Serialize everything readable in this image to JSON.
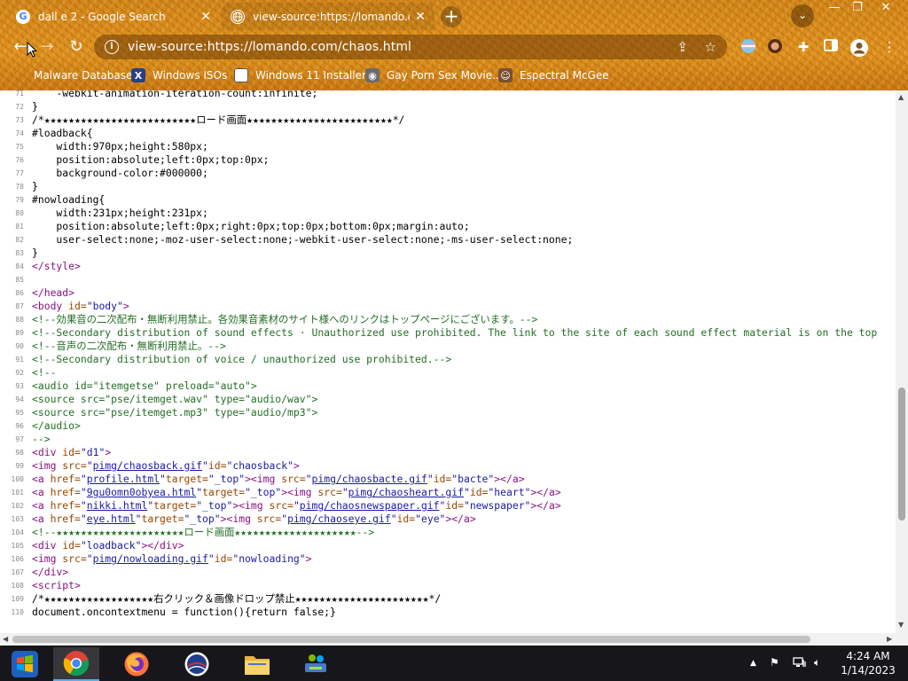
{
  "tabs": [
    {
      "title": "dall e 2 - Google Search",
      "icon": "google-icon"
    },
    {
      "title": "view-source:https://lomando.com",
      "icon": "globe-icon"
    }
  ],
  "address_bar": {
    "url": "view-source:https://lomando.com/chaos.html"
  },
  "bookmarks": [
    {
      "label": "Malware Database"
    },
    {
      "label": "Windows ISOs"
    },
    {
      "label": "Windows 11 Installer"
    },
    {
      "label": "Gay Porn Sex Movie..."
    },
    {
      "label": "Espectral McGee"
    }
  ],
  "source": {
    "lines": [
      {
        "n": "71",
        "segs": [
          {
            "t": "    -webkit-animation-iteration-count:infinite;",
            "c": ""
          }
        ]
      },
      {
        "n": "72",
        "segs": [
          {
            "t": "}",
            "c": ""
          }
        ]
      },
      {
        "n": "73",
        "segs": [
          {
            "t": "/*★★★★★★★★★★★★★★★★★★★★★★★★★ロード画面★★★★★★★★★★★★★★★★★★★★★★★★*/",
            "c": ""
          }
        ]
      },
      {
        "n": "74",
        "segs": [
          {
            "t": "#loadback{",
            "c": ""
          }
        ]
      },
      {
        "n": "75",
        "segs": [
          {
            "t": "    width:970px;height:580px;",
            "c": ""
          }
        ]
      },
      {
        "n": "76",
        "segs": [
          {
            "t": "    position:absolute;left:0px;top:0px;",
            "c": ""
          }
        ]
      },
      {
        "n": "77",
        "segs": [
          {
            "t": "    background-color:#000000;",
            "c": ""
          }
        ]
      },
      {
        "n": "78",
        "segs": [
          {
            "t": "}",
            "c": ""
          }
        ]
      },
      {
        "n": "79",
        "segs": [
          {
            "t": "#nowloading{",
            "c": ""
          }
        ]
      },
      {
        "n": "80",
        "segs": [
          {
            "t": "    width:231px;height:231px;",
            "c": ""
          }
        ]
      },
      {
        "n": "81",
        "segs": [
          {
            "t": "    position:absolute;left:0px;right:0px;top:0px;bottom:0px;margin:auto;",
            "c": ""
          }
        ]
      },
      {
        "n": "82",
        "segs": [
          {
            "t": "    user-select:none;-moz-user-select:none;-webkit-user-select:none;-ms-user-select:none;",
            "c": ""
          }
        ]
      },
      {
        "n": "83",
        "segs": [
          {
            "t": "}",
            "c": ""
          }
        ]
      },
      {
        "n": "84",
        "segs": [
          {
            "t": "</style>",
            "c": "tag"
          }
        ]
      },
      {
        "n": "85",
        "segs": []
      },
      {
        "n": "86",
        "segs": [
          {
            "t": "</head>",
            "c": "tag"
          }
        ]
      },
      {
        "n": "87",
        "segs": [
          {
            "t": "<body ",
            "c": "tag"
          },
          {
            "t": "id=",
            "c": "an"
          },
          {
            "t": "\"body\"",
            "c": "av"
          },
          {
            "t": ">",
            "c": "tag"
          }
        ]
      },
      {
        "n": "88",
        "segs": [
          {
            "t": "<!--効果音の二次配布・無断利用禁止。各効果音素材のサイト様へのリンクはトップページにございます。-->",
            "c": "cm"
          }
        ]
      },
      {
        "n": "89",
        "segs": [
          {
            "t": "<!--Secondary distribution of sound effects · Unauthorized use prohibited. The link to the site of each sound effect material is on the top",
            "c": "cm"
          }
        ]
      },
      {
        "n": "90",
        "segs": [
          {
            "t": "<!--音声の二次配布・無断利用禁止。-->",
            "c": "cm"
          }
        ]
      },
      {
        "n": "91",
        "segs": [
          {
            "t": "<!--Secondary distribution of voice / unauthorized use prohibited.-->",
            "c": "cm"
          }
        ]
      },
      {
        "n": "92",
        "segs": [
          {
            "t": "<!--",
            "c": "cm"
          }
        ]
      },
      {
        "n": "93",
        "segs": [
          {
            "t": "<audio id=\"itemgetse\" preload=\"auto\">",
            "c": "cm"
          }
        ]
      },
      {
        "n": "94",
        "segs": [
          {
            "t": "<source src=\"pse/itemget.wav\" type=\"audio/wav\">",
            "c": "cm"
          }
        ]
      },
      {
        "n": "95",
        "segs": [
          {
            "t": "<source src=\"pse/itemget.mp3\" type=\"audio/mp3\">",
            "c": "cm"
          }
        ]
      },
      {
        "n": "96",
        "segs": [
          {
            "t": "</audio>",
            "c": "cm"
          }
        ]
      },
      {
        "n": "97",
        "segs": [
          {
            "t": "-->",
            "c": "cm"
          }
        ]
      },
      {
        "n": "98",
        "segs": [
          {
            "t": "<div ",
            "c": "tag"
          },
          {
            "t": "id=",
            "c": "an"
          },
          {
            "t": "\"d1\"",
            "c": "av"
          },
          {
            "t": ">",
            "c": "tag"
          }
        ]
      },
      {
        "n": "99",
        "segs": [
          {
            "t": "<img ",
            "c": "tag"
          },
          {
            "t": "src=",
            "c": "an"
          },
          {
            "t": "\"",
            "c": "av"
          },
          {
            "t": "pimg/chaosback.gif",
            "c": "lk"
          },
          {
            "t": "\"",
            "c": "av"
          },
          {
            "t": "id=",
            "c": "an"
          },
          {
            "t": "\"chaosback\"",
            "c": "av"
          },
          {
            "t": ">",
            "c": "tag"
          }
        ]
      },
      {
        "n": "100",
        "segs": [
          {
            "t": "<a ",
            "c": "tag"
          },
          {
            "t": "href=",
            "c": "an"
          },
          {
            "t": "\"",
            "c": "av"
          },
          {
            "t": "profile.html",
            "c": "lk"
          },
          {
            "t": "\"",
            "c": "av"
          },
          {
            "t": "target=",
            "c": "an"
          },
          {
            "t": "\"_top\"",
            "c": "av"
          },
          {
            "t": "><img ",
            "c": "tag"
          },
          {
            "t": "src=",
            "c": "an"
          },
          {
            "t": "\"",
            "c": "av"
          },
          {
            "t": "pimg/chaosbacte.gif",
            "c": "lk"
          },
          {
            "t": "\"",
            "c": "av"
          },
          {
            "t": "id=",
            "c": "an"
          },
          {
            "t": "\"bacte\"",
            "c": "av"
          },
          {
            "t": "></a>",
            "c": "tag"
          }
        ]
      },
      {
        "n": "101",
        "segs": [
          {
            "t": "<a ",
            "c": "tag"
          },
          {
            "t": "href=",
            "c": "an"
          },
          {
            "t": "\"",
            "c": "av"
          },
          {
            "t": "9gu0omn0obyea.html",
            "c": "lk"
          },
          {
            "t": "\"",
            "c": "av"
          },
          {
            "t": "target=",
            "c": "an"
          },
          {
            "t": "\"_top\"",
            "c": "av"
          },
          {
            "t": "><img ",
            "c": "tag"
          },
          {
            "t": "src=",
            "c": "an"
          },
          {
            "t": "\"",
            "c": "av"
          },
          {
            "t": "pimg/chaosheart.gif",
            "c": "lk"
          },
          {
            "t": "\"",
            "c": "av"
          },
          {
            "t": "id=",
            "c": "an"
          },
          {
            "t": "\"heart\"",
            "c": "av"
          },
          {
            "t": "></a>",
            "c": "tag"
          }
        ]
      },
      {
        "n": "102",
        "segs": [
          {
            "t": "<a ",
            "c": "tag"
          },
          {
            "t": "href=",
            "c": "an"
          },
          {
            "t": "\"",
            "c": "av"
          },
          {
            "t": "nikki.html",
            "c": "lk"
          },
          {
            "t": "\"",
            "c": "av"
          },
          {
            "t": "target=",
            "c": "an"
          },
          {
            "t": "\"_top\"",
            "c": "av"
          },
          {
            "t": "><img ",
            "c": "tag"
          },
          {
            "t": "src=",
            "c": "an"
          },
          {
            "t": "\"",
            "c": "av"
          },
          {
            "t": "pimg/chaosnewspaper.gif",
            "c": "lk"
          },
          {
            "t": "\"",
            "c": "av"
          },
          {
            "t": "id=",
            "c": "an"
          },
          {
            "t": "\"newspaper\"",
            "c": "av"
          },
          {
            "t": "></a>",
            "c": "tag"
          }
        ]
      },
      {
        "n": "103",
        "segs": [
          {
            "t": "<a ",
            "c": "tag"
          },
          {
            "t": "href=",
            "c": "an"
          },
          {
            "t": "\"",
            "c": "av"
          },
          {
            "t": "eye.html",
            "c": "lk"
          },
          {
            "t": "\"",
            "c": "av"
          },
          {
            "t": "target=",
            "c": "an"
          },
          {
            "t": "\"_top\"",
            "c": "av"
          },
          {
            "t": "><img ",
            "c": "tag"
          },
          {
            "t": "src=",
            "c": "an"
          },
          {
            "t": "\"",
            "c": "av"
          },
          {
            "t": "pimg/chaoseye.gif",
            "c": "lk"
          },
          {
            "t": "\"",
            "c": "av"
          },
          {
            "t": "id=",
            "c": "an"
          },
          {
            "t": "\"eye\"",
            "c": "av"
          },
          {
            "t": "></a>",
            "c": "tag"
          }
        ]
      },
      {
        "n": "104",
        "segs": [
          {
            "t": "<!--★★★★★★★★★★★★★★★★★★★★★ロード画面★★★★★★★★★★★★★★★★★★★★-->",
            "c": "cm"
          }
        ]
      },
      {
        "n": "105",
        "segs": [
          {
            "t": "<div ",
            "c": "tag"
          },
          {
            "t": "id=",
            "c": "an"
          },
          {
            "t": "\"loadback\"",
            "c": "av"
          },
          {
            "t": "></div>",
            "c": "tag"
          }
        ]
      },
      {
        "n": "106",
        "segs": [
          {
            "t": "<img ",
            "c": "tag"
          },
          {
            "t": "src=",
            "c": "an"
          },
          {
            "t": "\"",
            "c": "av"
          },
          {
            "t": "pimg/nowloading.gif",
            "c": "lk"
          },
          {
            "t": "\"",
            "c": "av"
          },
          {
            "t": "id=",
            "c": "an"
          },
          {
            "t": "\"nowloading\"",
            "c": "av"
          },
          {
            "t": ">",
            "c": "tag"
          }
        ]
      },
      {
        "n": "107",
        "segs": [
          {
            "t": "</div>",
            "c": "tag"
          }
        ]
      },
      {
        "n": "108",
        "segs": [
          {
            "t": "<script>",
            "c": "tag"
          }
        ]
      },
      {
        "n": "109",
        "segs": [
          {
            "t": "/*★★★★★★★★★★★★★★★★★★右クリック＆画像ドロップ禁止★★★★★★★★★★★★★★★★★★★★★★*/",
            "c": ""
          }
        ]
      },
      {
        "n": "110",
        "segs": [
          {
            "t": "document.oncontextmenu = function(){return false;}",
            "c": ""
          }
        ]
      }
    ]
  },
  "taskbar": {
    "apps": [
      {
        "name": "windows-start",
        "icon": "windows-logo-icon"
      },
      {
        "name": "chrome",
        "icon": "chrome-icon"
      },
      {
        "name": "firefox",
        "icon": "firefox-icon"
      },
      {
        "name": "obama",
        "icon": "obama-logo-icon"
      },
      {
        "name": "file-explorer",
        "icon": "folder-icon"
      },
      {
        "name": "network",
        "icon": "network-people-icon"
      }
    ],
    "clock": {
      "time": "4:24 AM",
      "date": "1/14/2023"
    }
  },
  "colors": {
    "frame": "#d98a1c",
    "tag": "#881280",
    "attr_name": "#994500",
    "attr_value": "#1a1aa6",
    "comment": "#236e25"
  }
}
